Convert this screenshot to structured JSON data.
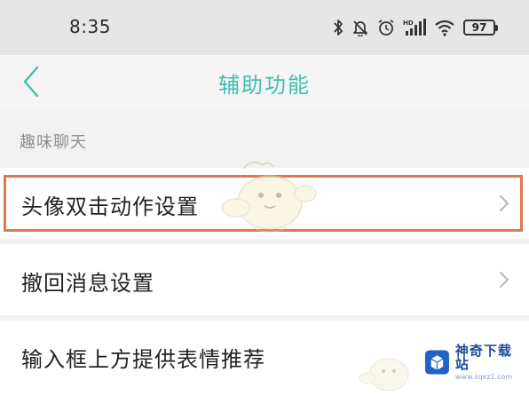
{
  "status_bar": {
    "time": "8:35",
    "battery": "97",
    "icons": [
      "bluetooth-icon",
      "mute-bell-icon",
      "alarm-icon",
      "hd-signal-icon",
      "wifi-icon",
      "battery-icon"
    ]
  },
  "header": {
    "back_icon": "chevron-left-icon",
    "title": "辅助功能"
  },
  "section": {
    "label": "趣味聊天"
  },
  "rows": [
    {
      "label": "头像双击动作设置",
      "chevron": "chevron-right-icon",
      "highlighted": true
    },
    {
      "label": "撤回消息设置",
      "chevron": "chevron-right-icon",
      "highlighted": false
    },
    {
      "label": "输入框上方提供表情推荐",
      "highlighted": false
    }
  ],
  "watermark": {
    "brand_name": "神奇下载站",
    "brand_url": "www.sqxz1.com",
    "brand_logo": "cube-logo"
  },
  "colors": {
    "accent": "#3fbfae",
    "highlight": "#e0774f",
    "background": "#f2f2f2",
    "row_bg": "#ffffff",
    "brand_blue": "#1d4e9e"
  }
}
